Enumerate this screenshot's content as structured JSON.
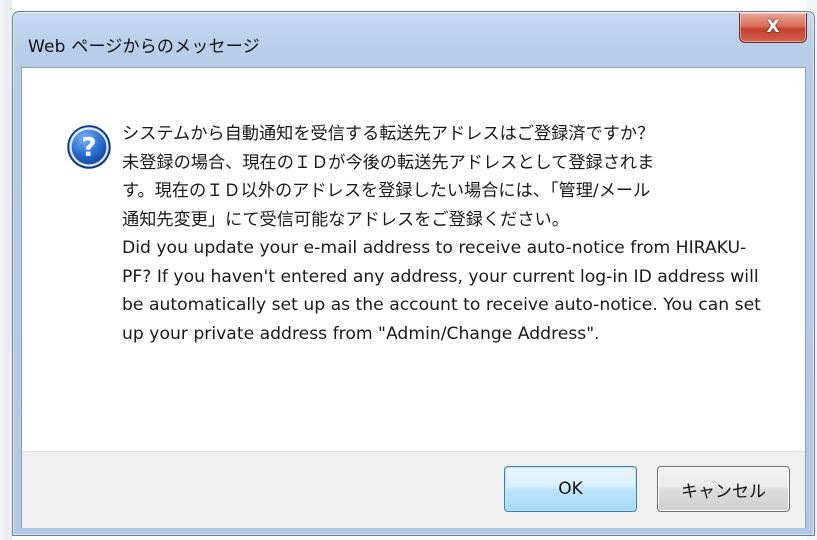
{
  "window": {
    "title": "Web ページからのメッセージ",
    "close_symbol": "X"
  },
  "icon": {
    "name": "question-icon",
    "glyph": "?",
    "color": "#1f5fbf"
  },
  "message": {
    "japanese": "システムから自動通知を受信する転送先アドレスはご登録済ですか？\n未登録の場合、現在のＩＤが今後の転送先アドレスとして登録されま\nす。現在のＩＤ以外のアドレスを登録したい場合には、「管理/メール\n通知先変更」にて受信可能なアドレスをご登録ください。",
    "english": "Did you update your e-mail address to receive auto-notice from HIRAKU-PF? If you haven't entered any address, your current log-in ID address will be automatically set up as the account to receive auto-notice. You can set up your private address from \"Admin/Change Address\"."
  },
  "buttons": {
    "ok_label": "OK",
    "cancel_label": "キャンセル"
  }
}
